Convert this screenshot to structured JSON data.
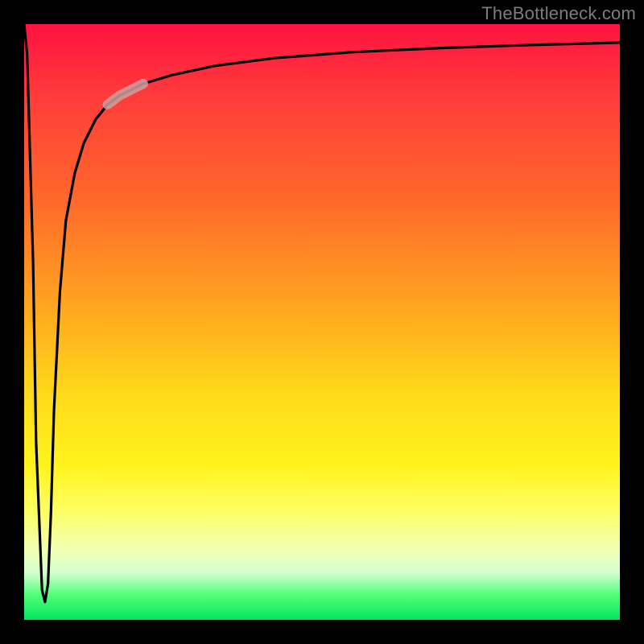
{
  "watermark": "TheBottleneck.com",
  "chart_data": {
    "type": "line",
    "title": "",
    "xlabel": "",
    "ylabel": "",
    "xlim": [
      0,
      100
    ],
    "ylim": [
      0,
      100
    ],
    "grid": false,
    "legend": false,
    "series": [
      {
        "name": "curve",
        "x": [
          0.0,
          0.5,
          1.5,
          2.0,
          3.0,
          3.5,
          4.0,
          4.5,
          5.0,
          6.0,
          7.0,
          8.5,
          10.0,
          12.0,
          14.0,
          16.0,
          20.0,
          25.0,
          32.0,
          42.0,
          55.0,
          70.0,
          85.0,
          100.0
        ],
        "y": [
          100.0,
          95.0,
          60.0,
          30.0,
          5.0,
          3.0,
          6.0,
          18.0,
          35.0,
          55.0,
          67.0,
          75.0,
          80.0,
          84.0,
          86.5,
          88.0,
          90.0,
          91.5,
          93.0,
          94.3,
          95.3,
          96.0,
          96.5,
          96.9
        ]
      }
    ],
    "highlight_segment": {
      "x_start": 14.0,
      "x_end": 20.0
    },
    "background_gradient": {
      "top": "#ff1240",
      "mid": "#ffd91a",
      "bottom": "#00e660"
    }
  }
}
